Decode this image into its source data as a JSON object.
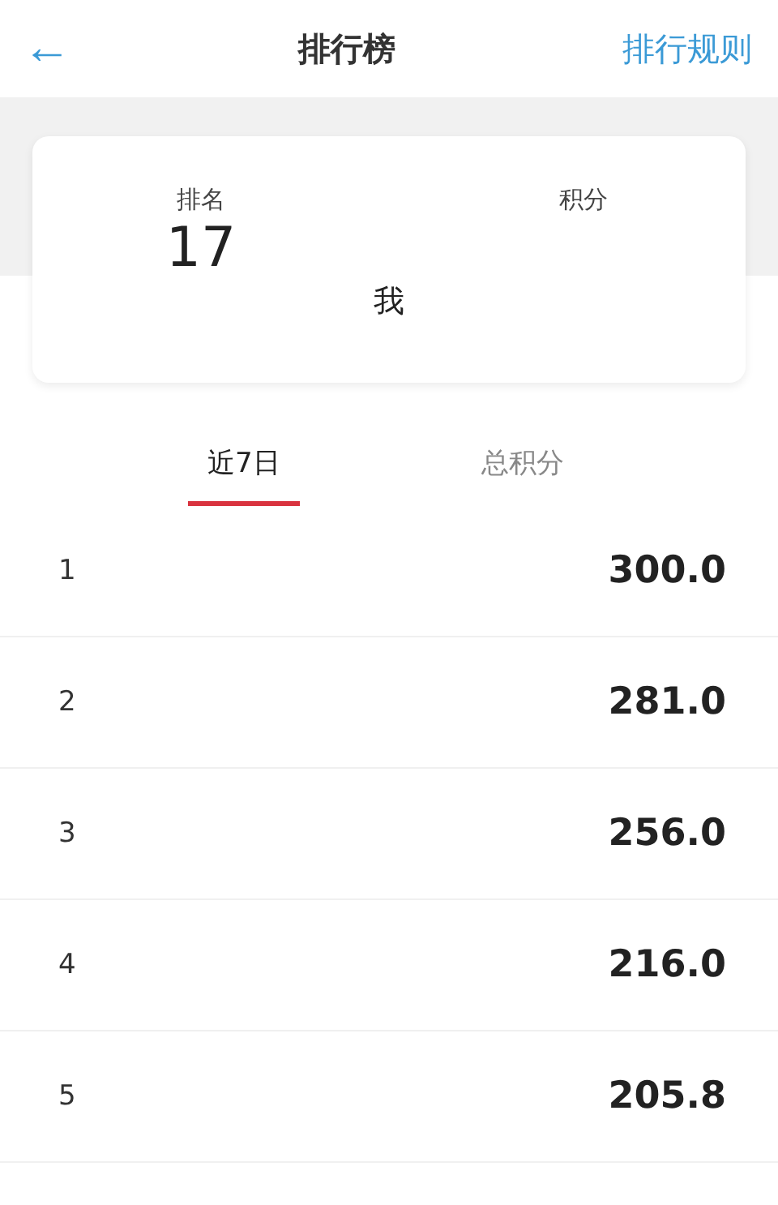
{
  "header": {
    "back": "←",
    "title": "排行榜",
    "rules_link": "排行规则"
  },
  "my_card": {
    "rank_label": "排名",
    "rank": "17",
    "score_label": "积分",
    "name": "我"
  },
  "tabs": [
    {
      "label": "近7日",
      "selected": true
    },
    {
      "label": "总积分",
      "selected": false
    }
  ],
  "rows": [
    {
      "rank": "1",
      "score": "300.0"
    },
    {
      "rank": "2",
      "score": "281.0"
    },
    {
      "rank": "3",
      "score": "256.0"
    },
    {
      "rank": "4",
      "score": "216.0"
    },
    {
      "rank": "5",
      "score": "205.8"
    }
  ]
}
